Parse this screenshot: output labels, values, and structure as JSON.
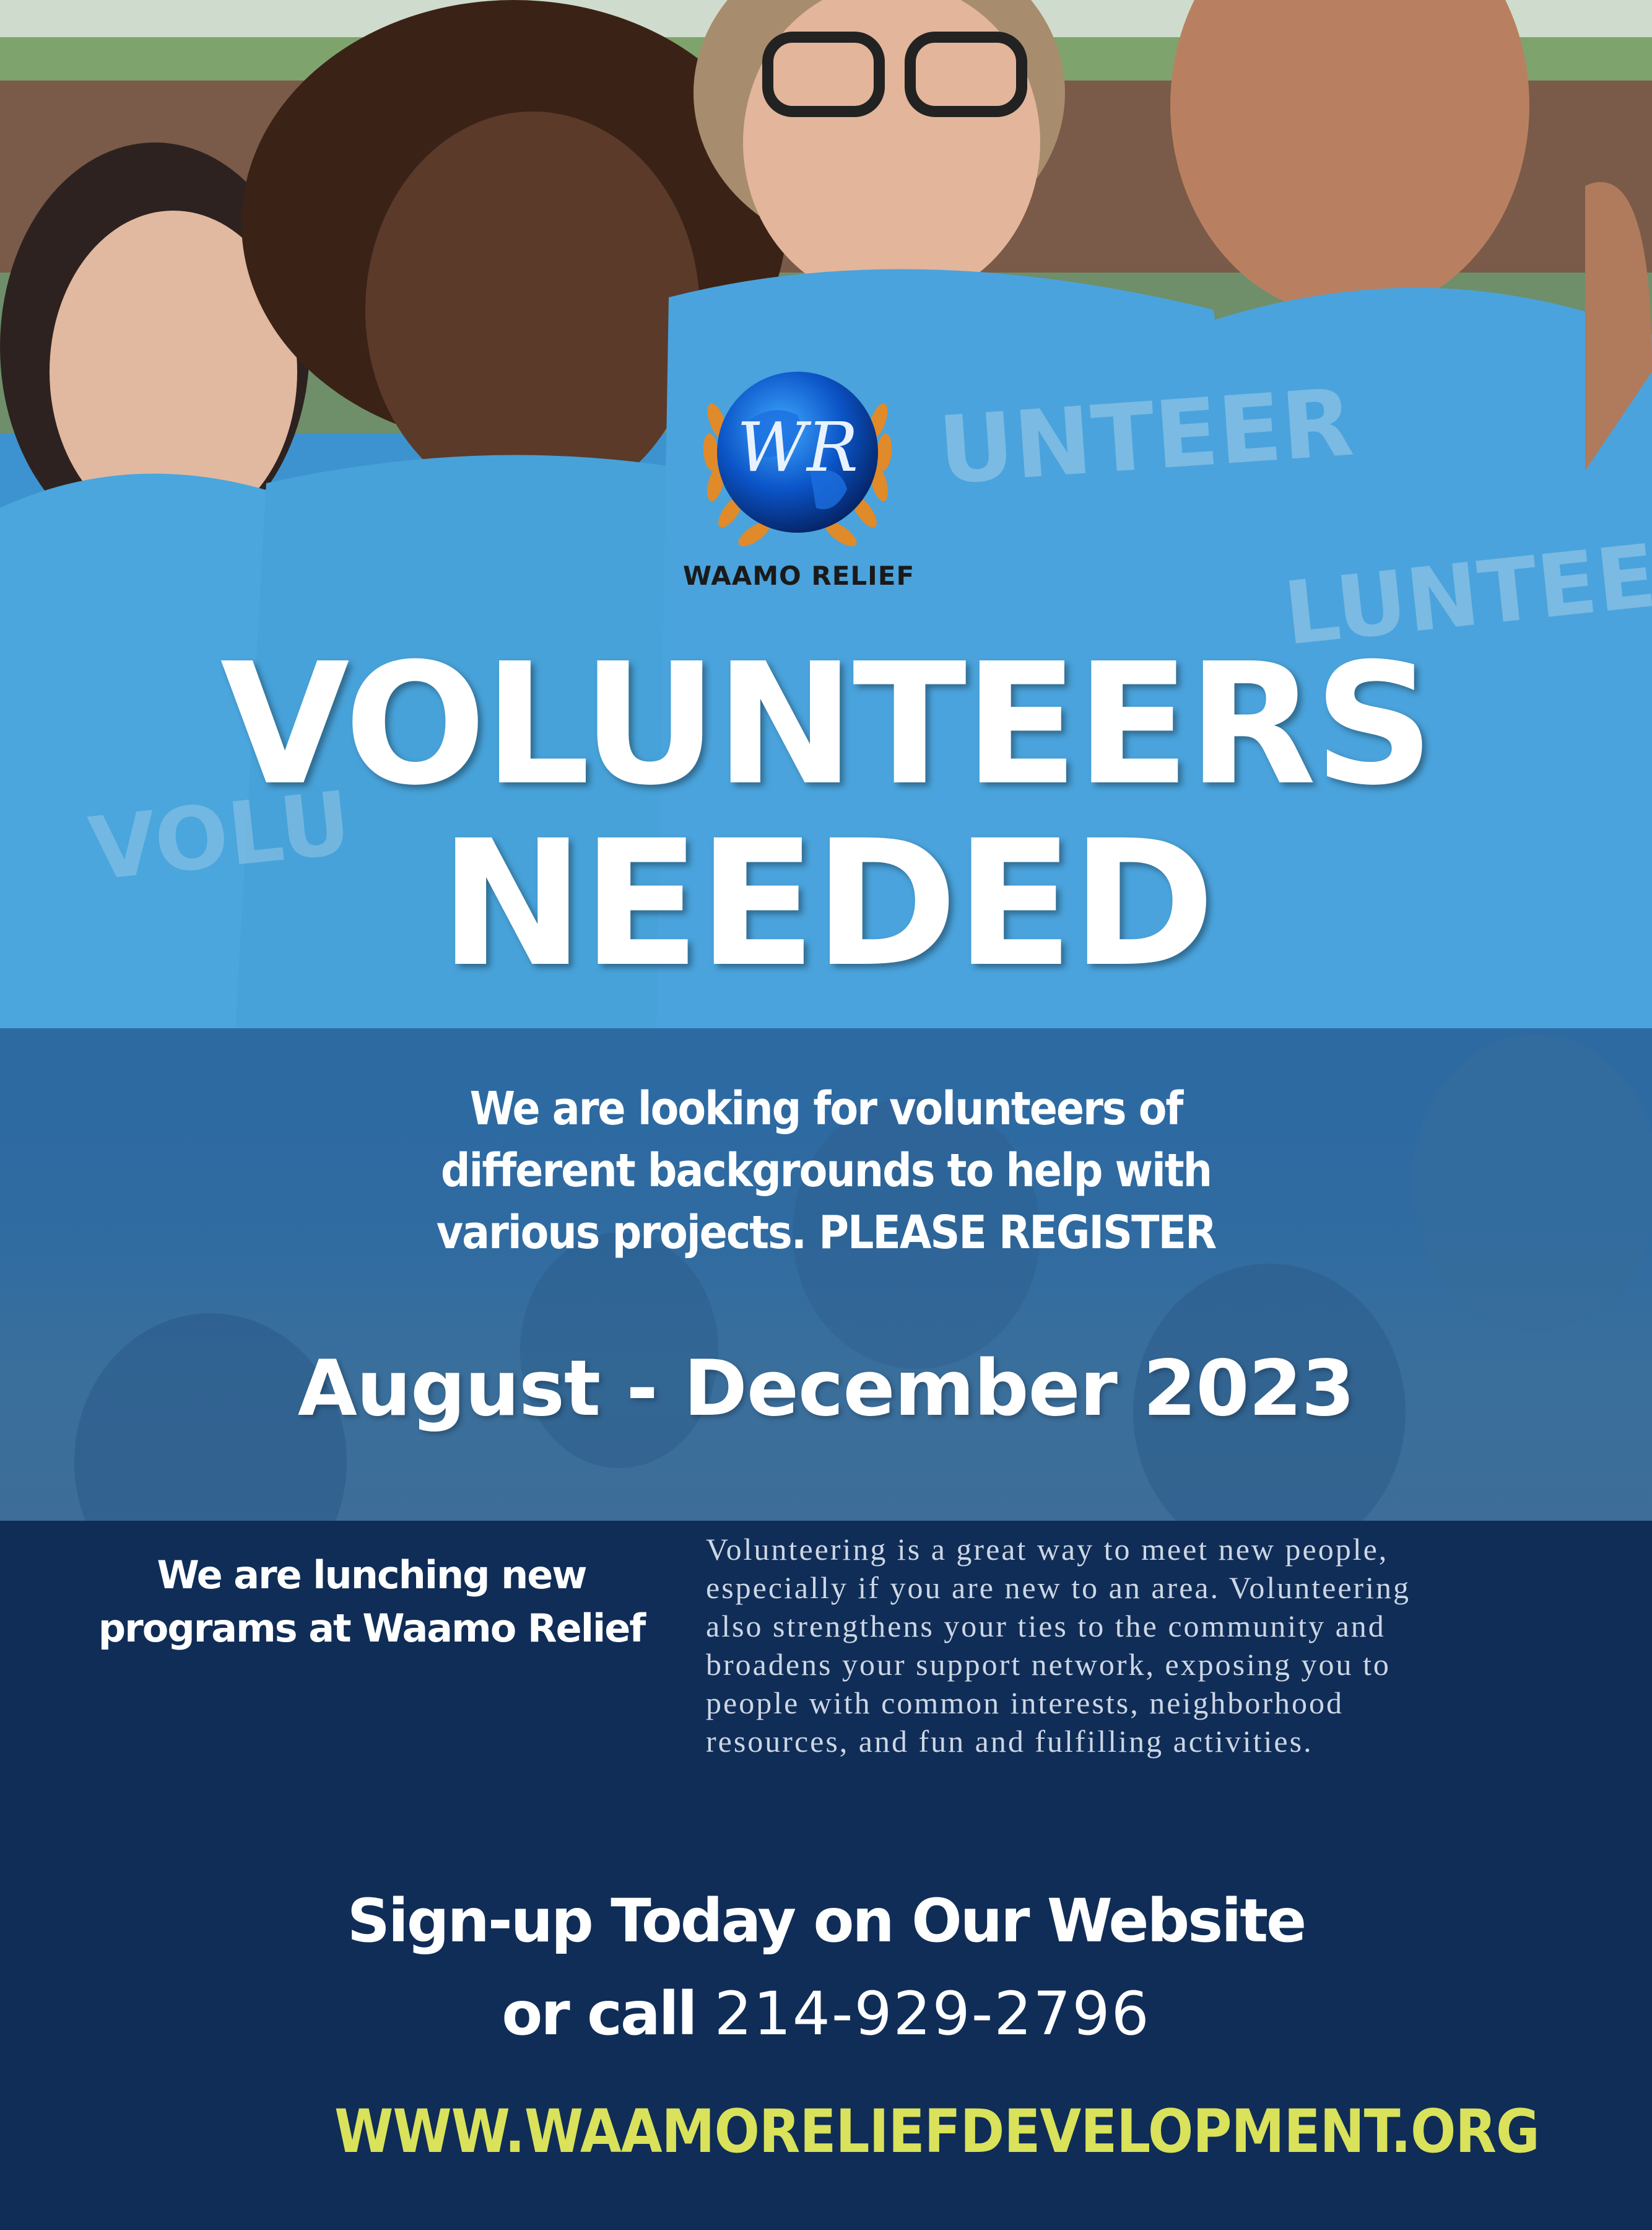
{
  "logo": {
    "monogram": "WR",
    "name": "WAAMO RELIEF"
  },
  "headline": {
    "line1": "VOLUNTEERS",
    "line2": "NEEDED"
  },
  "intro": {
    "line1": "We are looking for volunteers of",
    "line2": "different backgrounds to help with",
    "line3": "various projects. PLEASE REGISTER"
  },
  "dates": "August - December 2023",
  "launch": {
    "line1": "We are lunching new",
    "line2": "programs at Waamo Relief"
  },
  "description": {
    "line1": "Volunteering is a great way to meet new people,",
    "line2": "especially if you are new to an area. Volunteering",
    "line3": "also strengthens your ties to the community and",
    "line4": "broadens your support network, exposing you to",
    "line5": "people with common interests, neighborhood",
    "line6": "resources, and fun and fulfilling activities."
  },
  "signup": "Sign-up Today on Our Website",
  "call": {
    "label": "or call",
    "phone": "214-929-2796"
  },
  "website": "WWW.WAAMORELIEFDEVELOPMENT.ORG",
  "colors": {
    "navy": "#0f2d57",
    "band_blue": "#2f6ba1",
    "shirt_blue": "#4aa3dc",
    "url_yellow": "#d9e25a",
    "white": "#ffffff"
  }
}
